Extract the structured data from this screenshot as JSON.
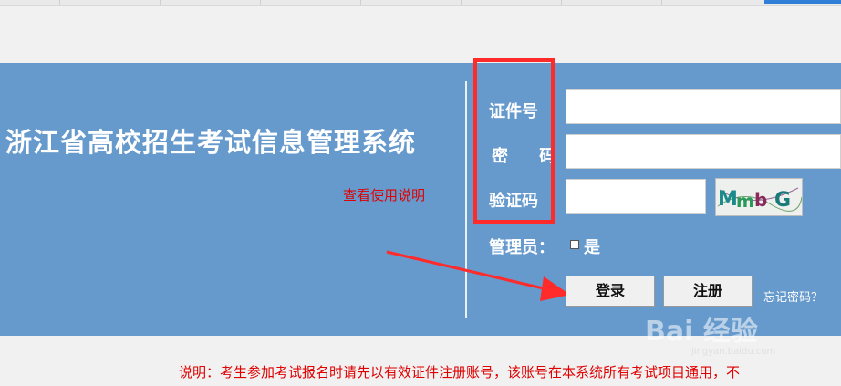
{
  "header": {
    "system_title": "浙江省高校招生考试信息管理系统",
    "help_link": "查看使用说明"
  },
  "login": {
    "id_label": "证件号",
    "password_label": "密 码",
    "captcha_label": "验证码",
    "captcha_text": "MmbG",
    "admin_label": "管理员：",
    "admin_checkbox_label": "是",
    "login_button": "登录",
    "register_button": "注册",
    "forgot_link": "忘记密码？"
  },
  "footer": {
    "note": "说明：考生参加考试报名时请先以有效证件注册账号，该账号在本系统所有考试项目通用，不"
  },
  "watermark": {
    "brand": "Bai 经验",
    "url": "jingyan.baidu.com"
  },
  "colors": {
    "banner": "#6699cc",
    "highlight": "#ff2a2a",
    "note_red": "#e00000"
  }
}
